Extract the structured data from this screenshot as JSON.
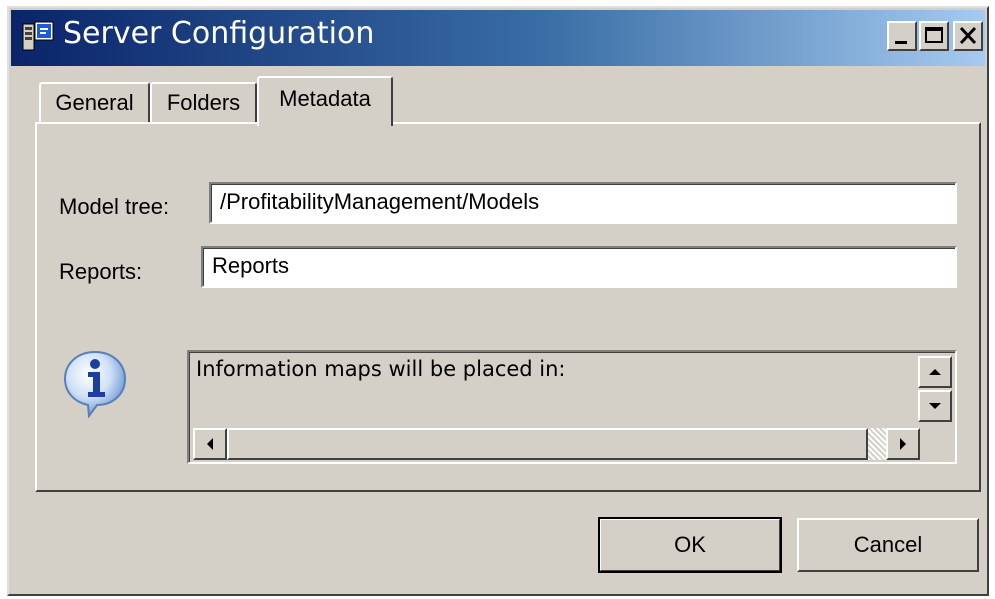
{
  "window": {
    "title": "Server Configuration"
  },
  "title_buttons": {
    "minimize_icon": "minimize-icon",
    "maximize_icon": "maximize-icon",
    "close_icon": "close-icon"
  },
  "tabs": [
    {
      "label": "General",
      "selected": false
    },
    {
      "label": "Folders",
      "selected": false
    },
    {
      "label": "Metadata",
      "selected": true
    }
  ],
  "form": {
    "model_tree": {
      "label": "Model tree:",
      "value": "/ProfitabilityManagement/Models"
    },
    "reports": {
      "label": "Reports:",
      "value": "Reports"
    }
  },
  "info": {
    "icon": "info-icon",
    "text": "Information maps will be placed in:"
  },
  "buttons": {
    "ok_label": "OK",
    "cancel_label": "Cancel"
  },
  "colors": {
    "titlebar_start": "#0a246a",
    "titlebar_end": "#a6caf0",
    "face": "#d4d0c8"
  }
}
